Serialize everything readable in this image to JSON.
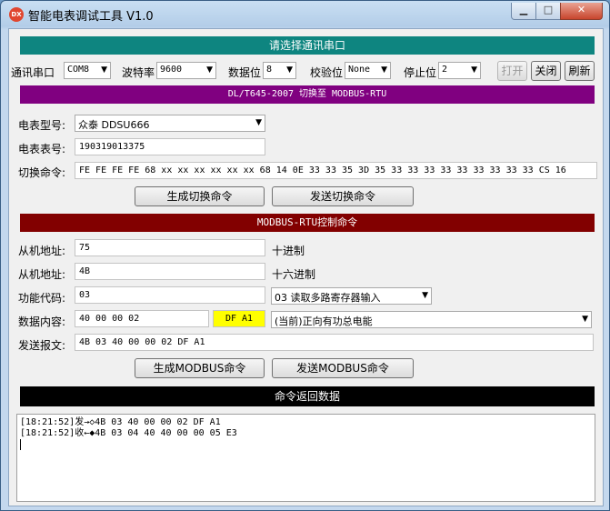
{
  "window": {
    "title": "智能电表调试工具 V1.0",
    "app_icon_text": "DX"
  },
  "serial": {
    "header": "请选择通讯串口",
    "port_label": "通讯串口",
    "port_value": "COM8",
    "baud_label": "波特率",
    "baud_value": "9600",
    "databits_label": "数据位",
    "databits_value": "8",
    "parity_label": "校验位",
    "parity_value": "None",
    "stopbits_label": "停止位",
    "stopbits_value": "2",
    "open_button": "打开",
    "close_button": "关闭",
    "refresh_button": "刷新"
  },
  "convert": {
    "header": "DL/T645-2007 切换至 MODBUS-RTU",
    "meter_type_label": "电表型号:",
    "meter_type_value": "众泰  DDSU666",
    "meter_no_label": "电表表号:",
    "meter_no_value": "190319013375",
    "switch_cmd_label": "切换命令:",
    "switch_cmd_value": "FE FE FE FE 68 xx xx xx xx xx xx 68 14 0E 33 33 35 3D 35 33 33 33 33 33 33 33 33 33 CS 16",
    "gen_button": "生成切换命令",
    "send_button": "发送切换命令"
  },
  "modbus": {
    "header": "MODBUS-RTU控制命令",
    "slave_dec_label": "从机地址:",
    "slave_dec_value": "75",
    "slave_dec_unit": "十进制",
    "slave_hex_label": "从机地址:",
    "slave_hex_value": "4B",
    "slave_hex_unit": "十六进制",
    "func_label": "功能代码:",
    "func_value": "03",
    "func_select": "03 读取多路寄存器输入",
    "data_label": "数据内容:",
    "data_value": "40 00 00 02",
    "crc_value": "DF A1",
    "data_select": "(当前)正向有功总电能",
    "send_msg_label": "发送报文:",
    "send_msg_value": "4B 03 40 00 00 02 DF A1",
    "gen_button": "生成MODBUS命令",
    "send_button": "发送MODBUS命令"
  },
  "response": {
    "header": "命令返回数据",
    "lines": [
      "[18:21:52]发→◇4B 03 40 00 00 02 DF A1",
      "[18:21:52]收←◆4B 03 04 40 40 00 00 05 E3"
    ]
  },
  "colors": {
    "serial_band": "#0e8580",
    "convert_band": "#800080",
    "modbus_band": "#820000",
    "response_band": "#000000",
    "crc_highlight": "#ffff00"
  }
}
